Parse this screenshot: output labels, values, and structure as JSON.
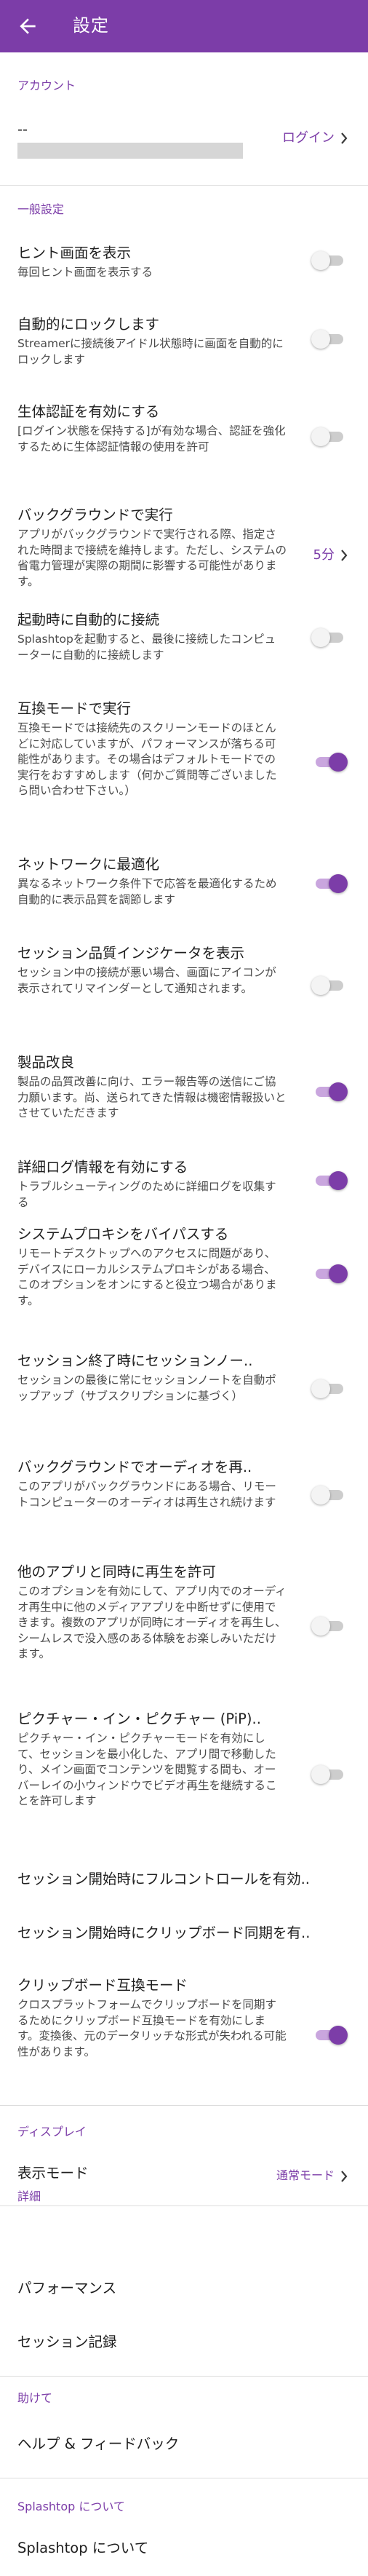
{
  "appbar": {
    "title": "設定",
    "back_icon": "arrow-back-icon",
    "color": "#7c3da8"
  },
  "sections": {
    "account": "アカウント",
    "general": "一般設定",
    "display": "ディスプレイ",
    "details": "詳細",
    "help": "助けて",
    "about": "Splashtop について"
  },
  "account": {
    "username": "--",
    "login_label": "ログイン"
  },
  "settings": {
    "hints": {
      "title": "ヒント画面を表示",
      "desc": "毎回ヒント画面を表示する",
      "enabled": false
    },
    "autolock": {
      "title": "自動的にロックします",
      "desc": "Streamerに接続後アイドル状態時に画面を自動的にロックします",
      "enabled": false
    },
    "biometric": {
      "title": "生体認証を有効にする",
      "desc": "[ログイン状態を保持する]が有効な場合、認証を強化するために生体認証情報の使用を許可",
      "enabled": false
    },
    "background": {
      "title": "バックグラウンドで実行",
      "desc": "アプリがバックグラウンドで実行される際、指定された時間まで接続を維持します。ただし、システムの省電力管理が実際の期間に影響する可能性があります。",
      "value": "5分"
    },
    "autoconnect": {
      "title": "起動時に自動的に接続",
      "desc": "Splashtopを起動すると、最後に接続したコンピューターに自動的に接続します",
      "enabled": false
    },
    "compat": {
      "title": "互換モードで実行",
      "desc": "互換モードでは接続先のスクリーンモードのほとんどに対応していますが、パフォーマンスが落ちる可能性があります。その場合はデフォルトモードでの実行をおすすめします（何かご質問等ございましたら問い合わせ下さい。）",
      "enabled": true
    },
    "network": {
      "title": "ネットワークに最適化",
      "desc": "異なるネットワーク条件下で応答を最適化するため自動的に表示品質を調節します",
      "enabled": true
    },
    "quality_indicator": {
      "title": "セッション品質インジケータを表示",
      "desc": "セッション中の接続が悪い場合、画面にアイコンが表示されてリマインダーとして通知されます。",
      "enabled": false
    },
    "improve": {
      "title": "製品改良",
      "desc": "製品の品質改善に向け、エラー報告等の送信にご協力願います。尚、送られてきた情報は機密情報扱いとさせていただきます",
      "enabled": true
    },
    "debug_log": {
      "title": "詳細ログ情報を有効にする",
      "desc": "トラブルシューティングのために詳細ログを収集する",
      "enabled": true
    },
    "proxy": {
      "title": "システムプロキシをバイパスする",
      "desc": "リモートデスクトップへのアクセスに問題があり、デバイスにローカルシステムプロキシがある場合、このオプションをオンにすると役立つ場合があります。",
      "enabled": true
    },
    "session_note": {
      "title": "セッション終了時にセッションノー..",
      "desc": "セッションの最後に常にセッションノートを自動ポップアップ（サブスクリプションに基づく）",
      "enabled": false
    },
    "bg_audio": {
      "title": "バックグラウンドでオーディオを再..",
      "desc": "このアプリがバックグラウンドにある場合、リモートコンピューターのオーディオは再生され続けます",
      "enabled": false
    },
    "mix_audio": {
      "title": "他のアプリと同時に再生を許可",
      "desc": "このオプションを有効にして、アプリ内でのオーディオ再生中に他のメディアアプリを中断せずに使用できます。複数のアプリが同時にオーディオを再生し、シームレスで没入感のある体験をお楽しみいただけます。",
      "enabled": false
    },
    "pip": {
      "title": "ピクチャー・イン・ピクチャー (PiP)..",
      "desc": "ピクチャー・イン・ピクチャーモードを有効にして、セッションを最小化した、アプリ間で移動したり、メイン画面でコンテンツを閲覧する間も、オーバーレイの小ウィンドウでビデオ再生を継続することを許可します",
      "enabled": false
    },
    "full_control": {
      "title": "セッション開始時にフルコントロールを有効.."
    },
    "clipboard_sync": {
      "title": "セッション開始時にクリップボード同期を有.."
    },
    "clipboard_compat": {
      "title": "クリップボード互換モード",
      "desc": "クロスプラットフォームでクリップボードを同期するためにクリップボード互換モードを有効にします。変換後、元のデータリッチな形式が失われる可能性があります。",
      "enabled": true
    }
  },
  "display": {
    "mode_title": "表示モード",
    "mode_value": "通常モード"
  },
  "details": {
    "performance": "パフォーマンス",
    "session_log": "セッション記録"
  },
  "help": {
    "feedback": "ヘルプ & フィードバック"
  },
  "about": {
    "about_label": "Splashtop について"
  }
}
